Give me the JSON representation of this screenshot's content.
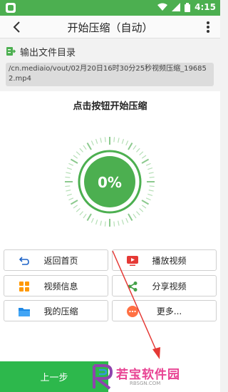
{
  "status": {
    "time": "4:15"
  },
  "appbar": {
    "title": "开始压缩（自动）"
  },
  "output": {
    "label": "输出文件目录",
    "path": "/cn.mediaio/vout/02月20日16时30分25秒视频压缩_196852.mp4"
  },
  "compress": {
    "prompt": "点击按钮开始压缩",
    "progress_text": "0%",
    "progress": 0
  },
  "buttons": [
    {
      "label": "返回首页",
      "icon": "return-icon",
      "color": "#1e64c8"
    },
    {
      "label": "播放视频",
      "icon": "play-video-icon",
      "color": "#e53935"
    },
    {
      "label": "视频信息",
      "icon": "grid-icon",
      "color": "#ff9800"
    },
    {
      "label": "分享视频",
      "icon": "share-icon",
      "color": "#43a047"
    },
    {
      "label": "我的压缩",
      "icon": "folder-icon",
      "color": "#1e88e5"
    },
    {
      "label": "更多...",
      "icon": "more-dots-icon",
      "color": "#ff7043"
    }
  ],
  "footer": {
    "prev_label": "上一步",
    "watermark": "若宝软件园",
    "watermark_sub": "RBSGN.COM"
  },
  "colors": {
    "accent": "#4caf50",
    "button_green": "#2db84c"
  }
}
